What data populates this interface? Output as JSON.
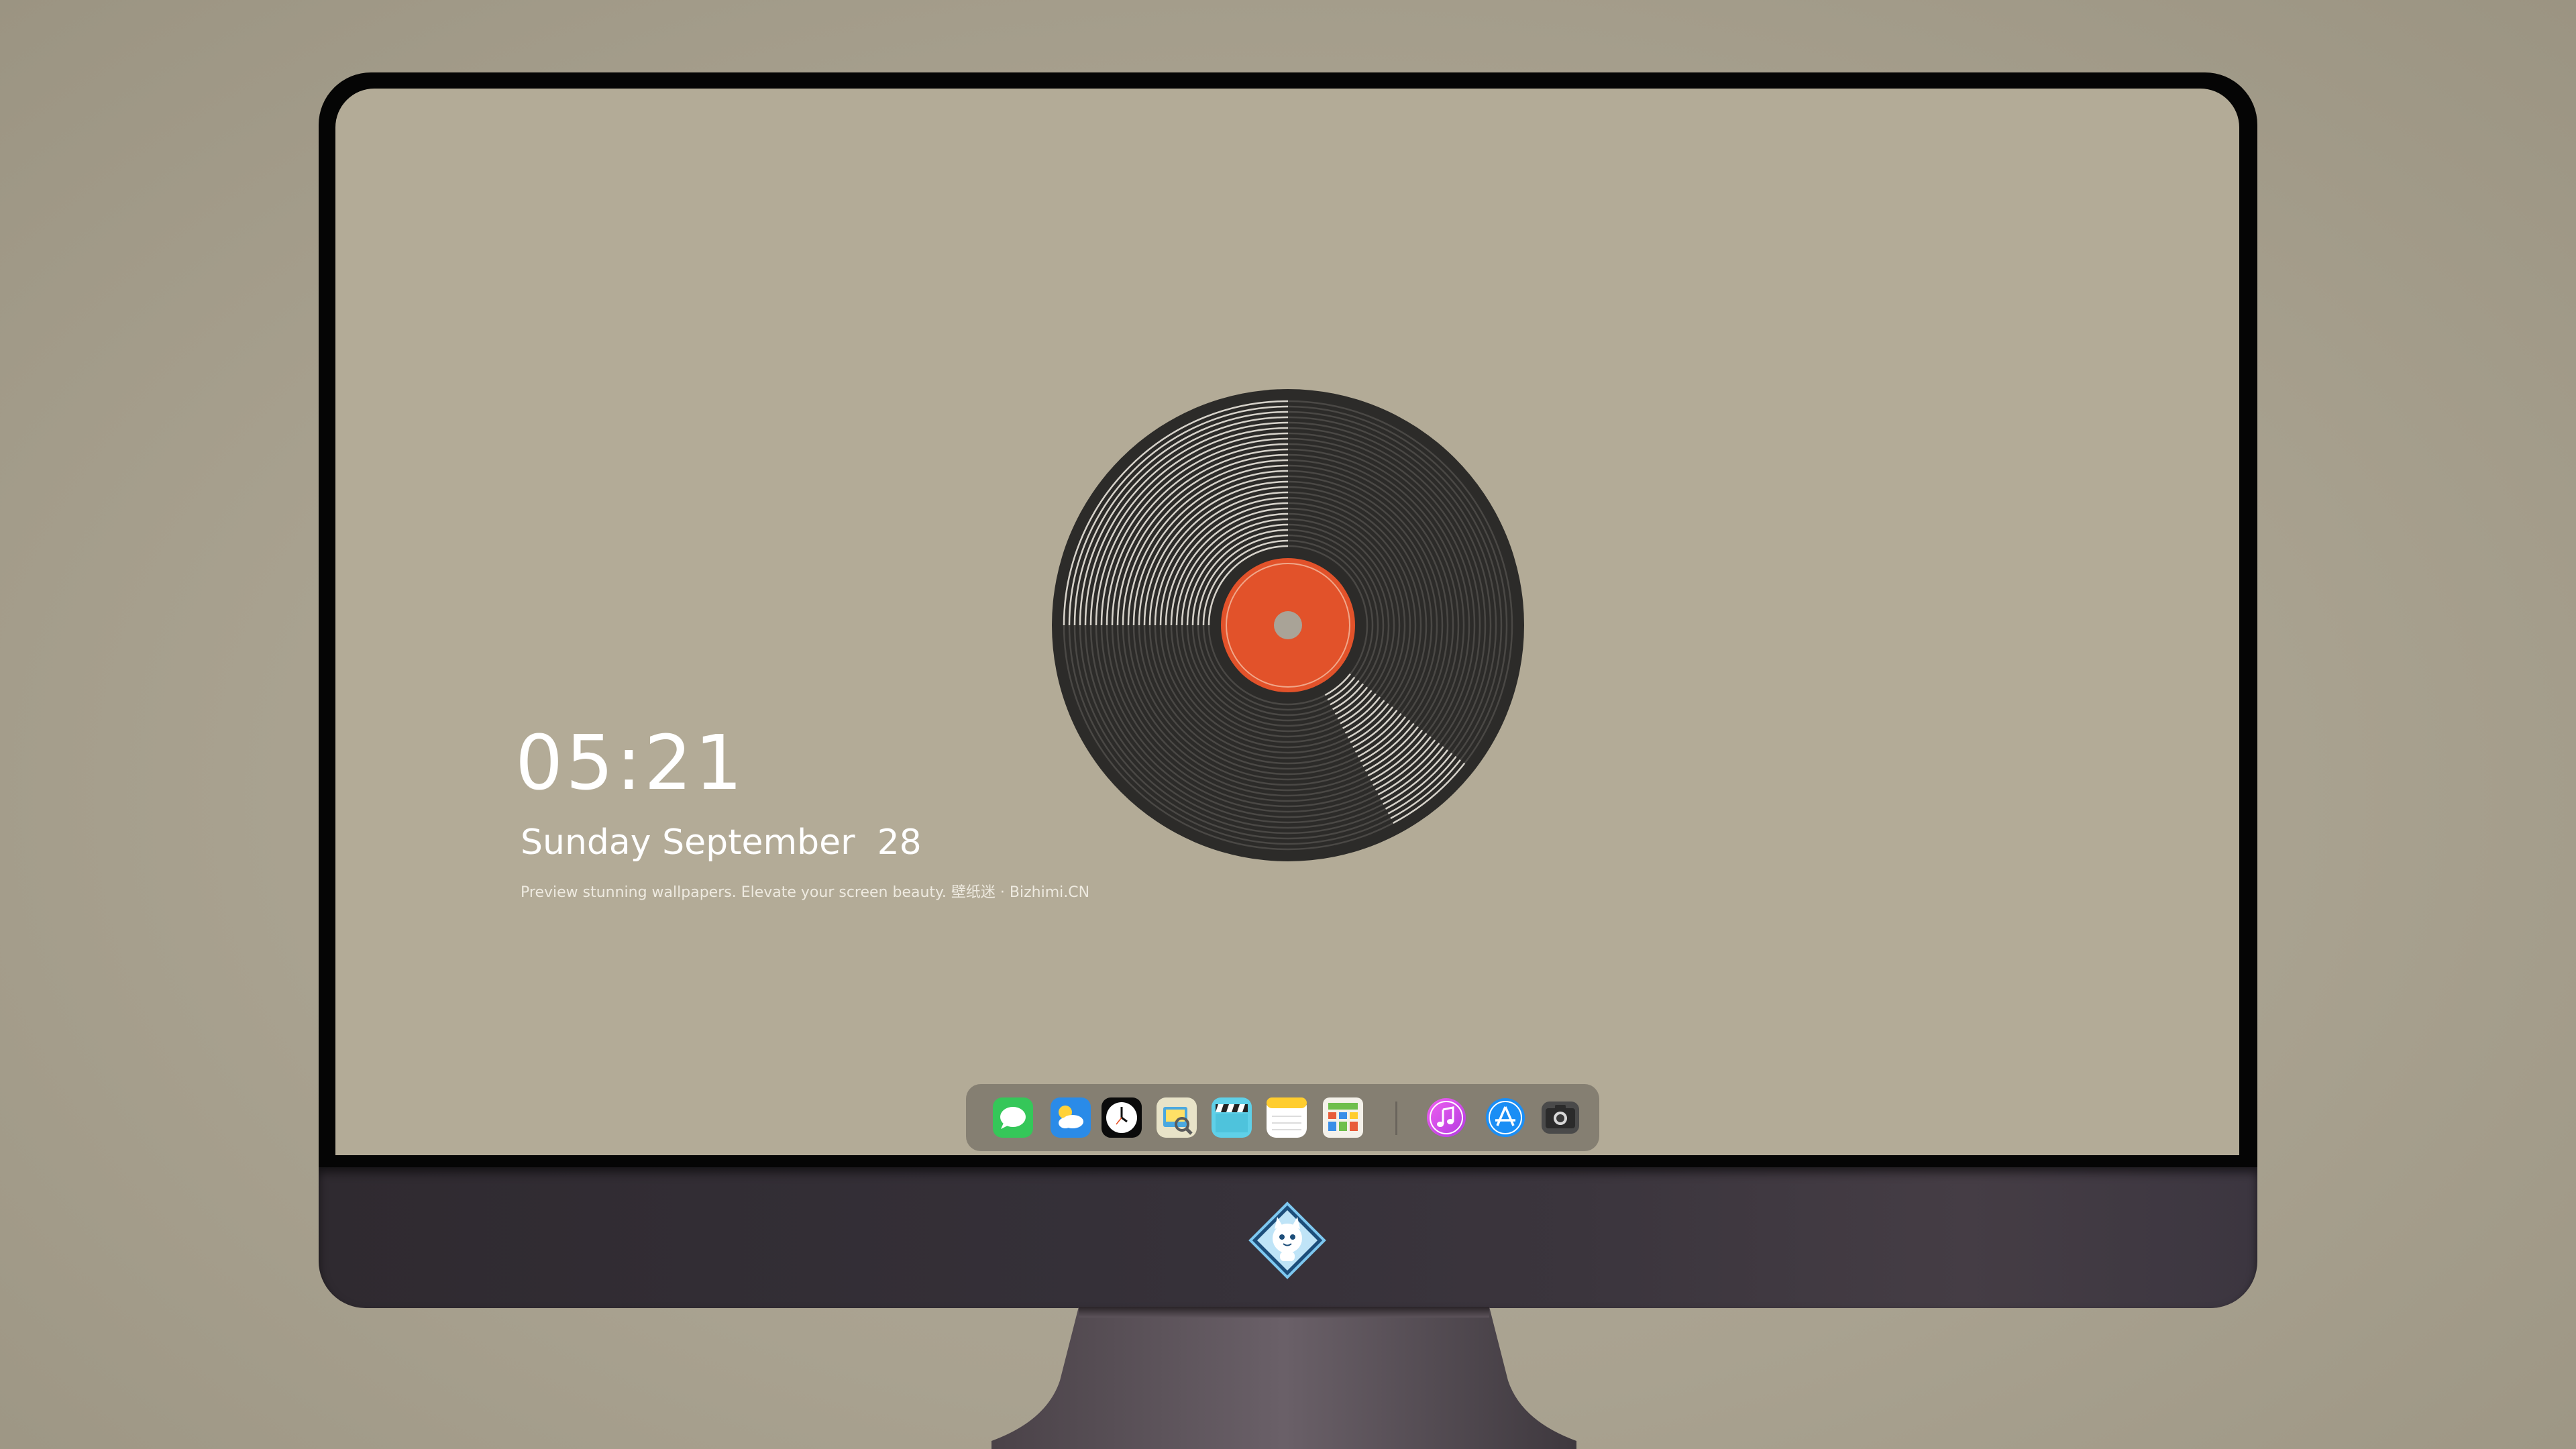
{
  "lockscreen": {
    "time": "05:21",
    "date": "Sunday September  28",
    "tagline": "Preview stunning wallpapers. Elevate your screen beauty. 壁纸迷 · Bizhimi.CN"
  },
  "wallpaper": {
    "subject": "vinyl-record",
    "background_color": "#b3ab97",
    "record_color": "#2c2b29",
    "label_color": "#e2522a"
  },
  "dock": {
    "items": [
      {
        "name": "messages-app",
        "icon": "messages-icon"
      },
      {
        "name": "weather-app",
        "icon": "weather-icon"
      },
      {
        "name": "clock-app",
        "icon": "clock-icon"
      },
      {
        "name": "preview-app",
        "icon": "preview-icon"
      },
      {
        "name": "clips-app",
        "icon": "clapperboard-icon"
      },
      {
        "name": "notes-app",
        "icon": "notes-icon"
      },
      {
        "name": "numbers-app",
        "icon": "numbers-icon"
      },
      {
        "name": "itunes-app",
        "icon": "music-note-icon"
      },
      {
        "name": "app-store-app",
        "icon": "app-store-icon"
      },
      {
        "name": "camera-app",
        "icon": "camera-icon"
      }
    ]
  },
  "monitor": {
    "chin_logo": "cat-mascot-logo"
  }
}
